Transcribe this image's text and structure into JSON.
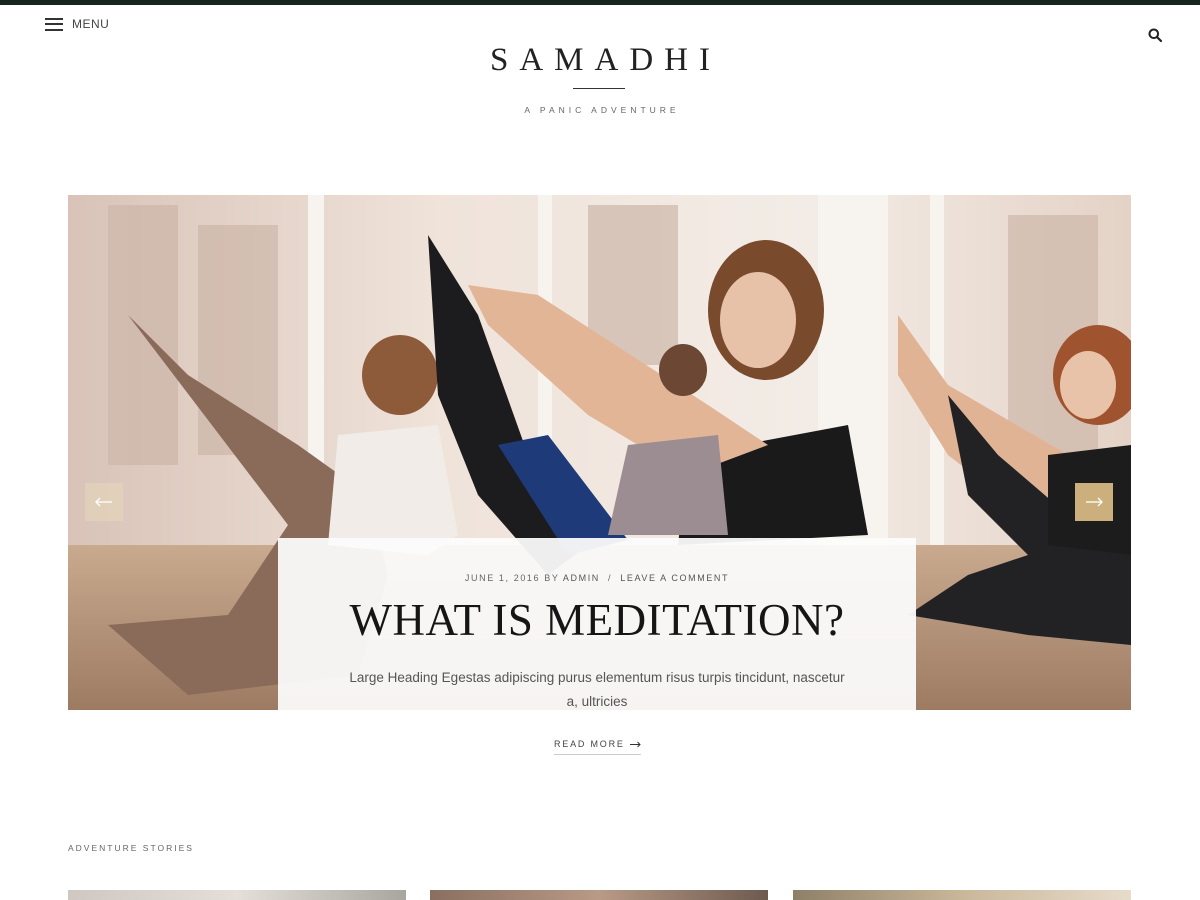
{
  "header": {
    "menu_label": "MENU",
    "site_title": "SAMADHI",
    "tagline": "A PANIC ADVENTURE"
  },
  "slider": {
    "slide": {
      "date": "JUNE 1, 2016",
      "by": "BY",
      "author": "ADMIN",
      "separator": "/",
      "comments_link": "LEAVE A COMMENT",
      "title": "WHAT IS MEDITATION?",
      "excerpt": "Large Heading Egestas adipiscing purus elementum risus turpis tincidunt, nascetur a, ultricies",
      "read_more": "READ MORE"
    }
  },
  "sections": {
    "adventure_stories_label": "ADVENTURE STORIES"
  },
  "colors": {
    "topbar": "#16261f",
    "accent": "#cbb07d"
  },
  "icons": {
    "menu": "hamburger-icon",
    "search": "search-icon",
    "prev": "arrow-left-icon",
    "next": "arrow-right-icon",
    "read_more": "arrow-right-icon"
  }
}
